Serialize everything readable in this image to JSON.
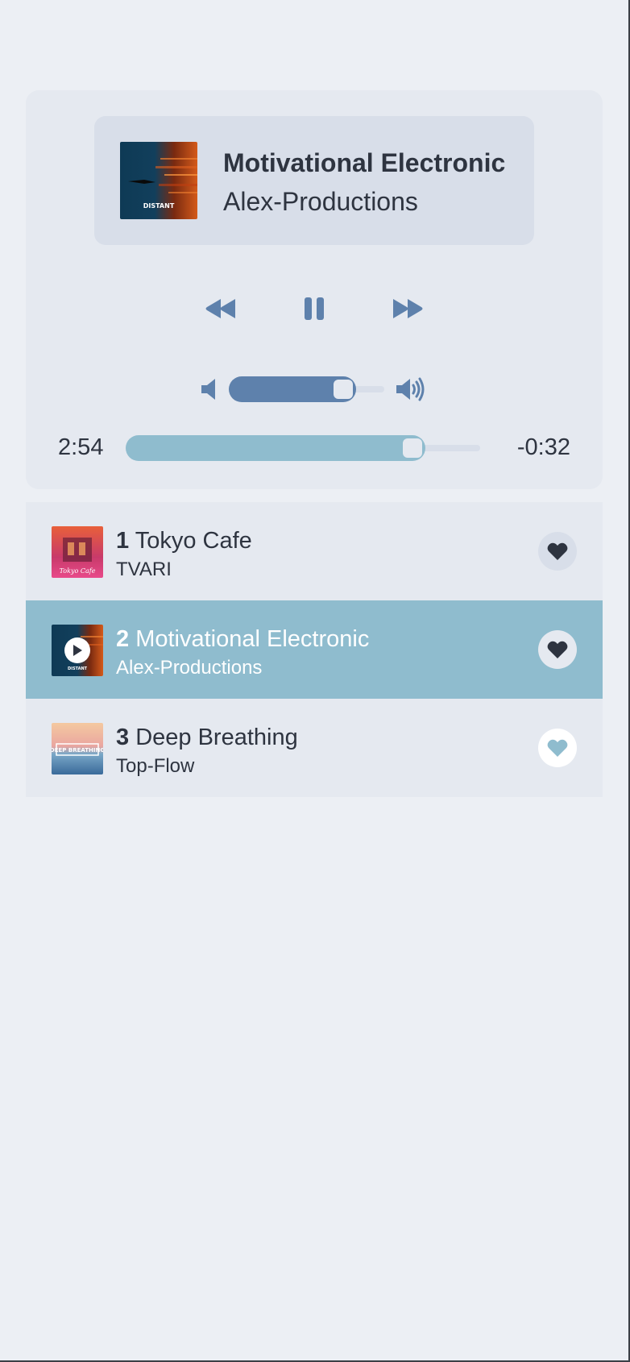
{
  "now_playing": {
    "title": "Motivational Electronic",
    "artist": "Alex-Productions",
    "cover_icon": "album-cover-distant"
  },
  "controls": {
    "prev_icon": "rewind-icon",
    "pause_icon": "pause-icon",
    "next_icon": "fast-forward-icon"
  },
  "volume": {
    "level": 0.82,
    "min_icon": "volume-low-icon",
    "max_icon": "volume-high-icon"
  },
  "progress": {
    "current": "2:54",
    "remaining": "-0:32",
    "fraction": 0.845
  },
  "playlist": [
    {
      "number": "1",
      "title": "Tokyo Cafe",
      "artist": "TVARI",
      "liked": false,
      "active": false
    },
    {
      "number": "2",
      "title": "Motivational Electronic",
      "artist": "Alex-Productions",
      "liked": false,
      "active": true
    },
    {
      "number": "3",
      "title": "Deep Breathing",
      "artist": "Top-Flow",
      "liked": true,
      "active": false
    }
  ],
  "colors": {
    "background": "#eceff4",
    "panel": "#e5e9f0",
    "card": "#d8dee9",
    "accent_blue": "#5e81ac",
    "accent_teal": "#8fbcce",
    "text": "#2e3440"
  }
}
